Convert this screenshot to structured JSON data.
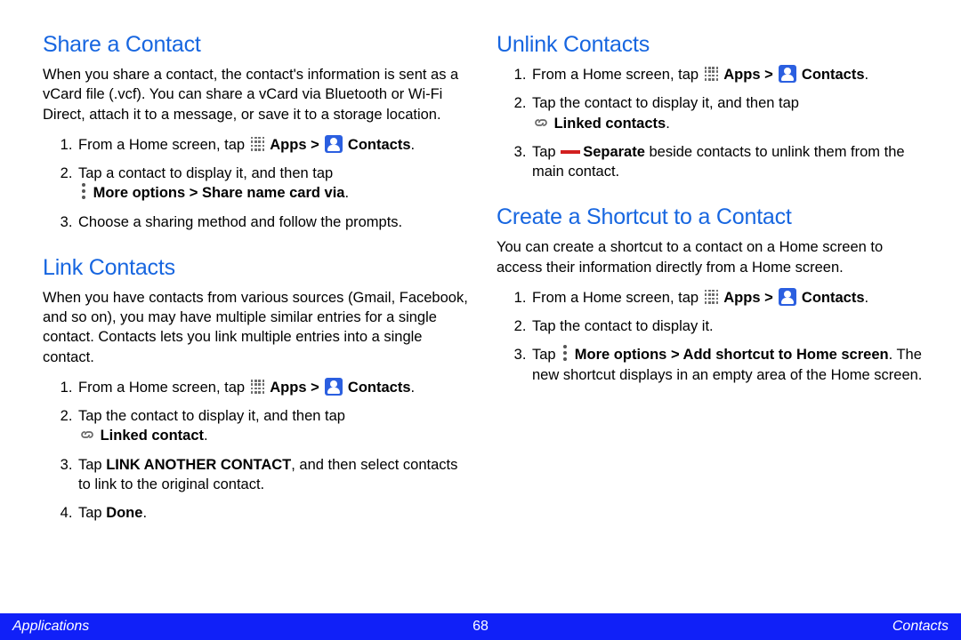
{
  "left": {
    "share": {
      "heading": "Share a Contact",
      "intro": "When you share a contact, the contact's information is sent as a vCard file (.vcf). You can share a vCard via Bluetooth or Wi-Fi Direct, attach it to a message, or save it to a storage location.",
      "step1_prefix": "From a Home screen, tap ",
      "apps_label": "Apps > ",
      "contacts_label": "Contacts",
      "step2_line1": "Tap a contact to display it, and then tap",
      "step2_bold": "More options > Share name card via",
      "step3": "Choose a sharing method and follow the prompts."
    },
    "link": {
      "heading": "Link Contacts",
      "intro": "When you have contacts from various sources (Gmail, Facebook, and so on), you may have multiple similar entries for a single contact. Contacts lets you link multiple entries into a single contact.",
      "step1_prefix": "From a Home screen, tap ",
      "apps_label": "Apps > ",
      "contacts_label": "Contacts",
      "step2_line1": "Tap the contact to display it, and then tap",
      "step2_bold": "Linked contact",
      "step3_prefix": "Tap ",
      "step3_bold": "LINK ANOTHER CONTACT",
      "step3_suffix": ", and then select contacts to link to the original contact.",
      "step4_prefix": "Tap ",
      "step4_bold": "Done"
    }
  },
  "right": {
    "unlink": {
      "heading": "Unlink Contacts",
      "step1_prefix": "From a Home screen, tap ",
      "apps_label": "Apps > ",
      "contacts_label": "Contacts",
      "step2_line1": "Tap the contact to display it, and then tap",
      "step2_bold": "Linked contacts",
      "step3_prefix": "Tap ",
      "step3_bold": "Separate",
      "step3_suffix": " beside contacts to unlink them from the main contact."
    },
    "shortcut": {
      "heading": "Create a Shortcut to a Contact",
      "intro": "You can create a shortcut to a contact on a Home screen to access their information directly from a Home screen.",
      "step1_prefix": "From a Home screen, tap ",
      "apps_label": "Apps > ",
      "contacts_label": "Contacts",
      "step2": "Tap the contact to display it.",
      "step3_prefix": "Tap ",
      "step3_bold": "More options > Add shortcut to Home screen",
      "step3_suffix": ". The new shortcut displays in an empty area of the Home screen."
    }
  },
  "footer": {
    "left": "Applications",
    "page": "68",
    "right": "Contacts"
  },
  "period": "."
}
